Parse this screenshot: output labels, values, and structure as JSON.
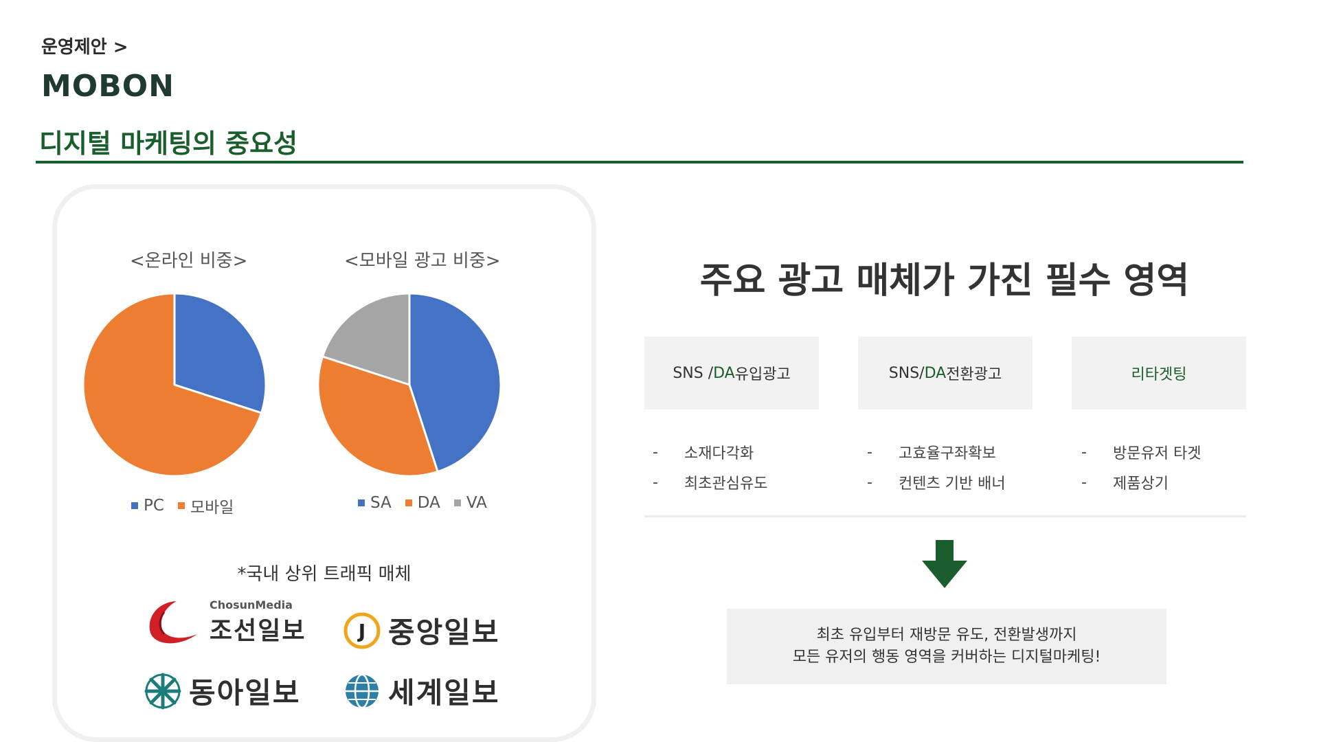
{
  "header": {
    "breadcrumb": "운영제안 >",
    "brand": "MOBON",
    "title": "디지털 마케팅의 중요성"
  },
  "colors": {
    "accent_green": "#1b5e2d",
    "pie_blue": "#4472c4",
    "pie_orange": "#ed7d31",
    "pie_gray": "#a5a5a5"
  },
  "chart_data": [
    {
      "type": "pie",
      "title": "<온라인 비중>",
      "categories": [
        "PC",
        "모바일"
      ],
      "values": [
        30,
        70
      ],
      "colors": [
        "#4472c4",
        "#ed7d31"
      ],
      "legend": "bottom"
    },
    {
      "type": "pie",
      "title": "<모바일 광고 비중>",
      "categories": [
        "SA",
        "DA",
        "VA"
      ],
      "values": [
        45,
        35,
        20
      ],
      "colors": [
        "#4472c4",
        "#ed7d31",
        "#a5a5a5"
      ],
      "legend": "bottom"
    }
  ],
  "media": {
    "note": "*국내 상위 트래픽 매체",
    "logos": [
      {
        "icon": "chosun-swoosh-icon",
        "small": "ChosunMedia",
        "name": "조선일보"
      },
      {
        "icon": "joongang-j-icon",
        "name": "중앙일보"
      },
      {
        "icon": "donga-snowflake-icon",
        "name": "동아일보"
      },
      {
        "icon": "segye-globe-icon",
        "name": "세계일보"
      }
    ]
  },
  "right": {
    "title": "주요 광고 매체가 가진 필수 영역",
    "cards": [
      {
        "pre": "SNS / ",
        "accent": "DA",
        "post": " 유입광고",
        "bullets": [
          "소재다각화",
          "최초관심유도"
        ]
      },
      {
        "pre": "SNS/ ",
        "accent": "DA",
        "post": " 전환광고",
        "bullets": [
          "고효율구좌확보",
          "컨텐츠 기반 배너"
        ]
      },
      {
        "pre": "",
        "accent": "리타겟팅",
        "post": "",
        "bullets": [
          "방문유저 타겟",
          "제품상기"
        ]
      }
    ],
    "bullet_dash": "-",
    "summary": {
      "line1": "최초 유입부터 재방문 유도, 전환발생까지",
      "line2": "모든 유저의 행동 영역을 커버하는 디지털마케팅!"
    }
  }
}
